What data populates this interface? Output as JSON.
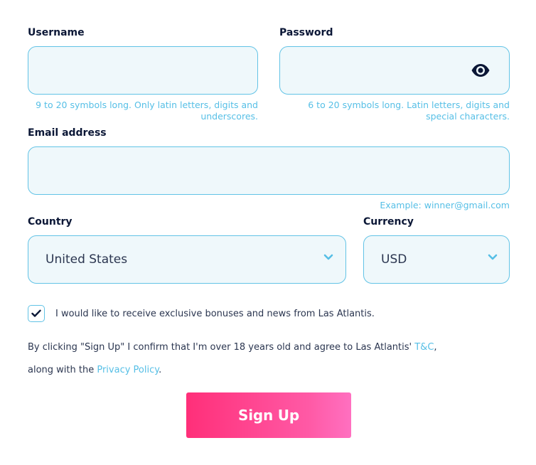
{
  "username": {
    "label": "Username",
    "value": "",
    "hint_line1": "9 to 20 symbols long. Only latin letters, digits and",
    "hint_line2": "underscores."
  },
  "password": {
    "label": "Password",
    "value": "",
    "toggle_icon": "eye-icon",
    "hint_line1": "6 to 20 symbols long. Latin letters, digits and",
    "hint_line2": "special characters."
  },
  "email": {
    "label": "Email address",
    "value": "",
    "hint": "Example: winner@gmail.com"
  },
  "country": {
    "label": "Country",
    "selected": "United States",
    "icon": "chevron-down-icon"
  },
  "currency": {
    "label": "Currency",
    "selected": "USD",
    "icon": "chevron-down-icon"
  },
  "newsletter": {
    "checked": true,
    "text": "I would like to receive exclusive bonuses and news from Las Atlantis."
  },
  "legal": {
    "part1": "By clicking \"Sign Up\" I confirm that I'm over 18 years old and agree to Las Atlantis' ",
    "terms_link": "T&C",
    "part2": ", along with the ",
    "privacy_link": "Privacy Policy",
    "part3": "."
  },
  "signup_button": {
    "label": "Sign Up"
  },
  "colors": {
    "accent": "#56bfe6",
    "field_bg": "#eff8fb",
    "field_border": "#62c3e6",
    "button_start": "#ff2f79",
    "button_end": "#ff70c0",
    "label": "#0b1736"
  }
}
